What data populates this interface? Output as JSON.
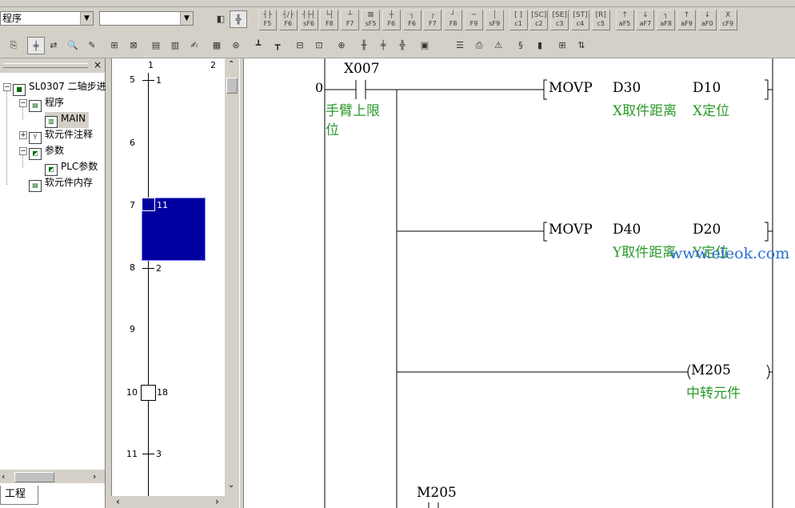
{
  "toolbar": {
    "program_combo": "程序",
    "second_combo": "",
    "fkeys": [
      {
        "glyph": "┤├",
        "label": "F5"
      },
      {
        "glyph": "┤/├",
        "label": "F6"
      },
      {
        "glyph": "┤├┤",
        "label": "sF6"
      },
      {
        "glyph": "└┤",
        "label": "F8"
      },
      {
        "glyph": "┴",
        "label": "F7"
      },
      {
        "glyph": "⊠",
        "label": "sF5"
      },
      {
        "glyph": "┼",
        "label": "F6"
      },
      {
        "glyph": "┐",
        "label": "F6"
      },
      {
        "glyph": "┌",
        "label": "F7"
      },
      {
        "glyph": "┘",
        "label": "F8"
      },
      {
        "glyph": "─",
        "label": "F9"
      },
      {
        "glyph": "│",
        "label": "sF9"
      },
      {
        "glyph": "[ ]",
        "label": "c1"
      },
      {
        "glyph": "[SC]",
        "label": "c2"
      },
      {
        "glyph": "[SE]",
        "label": "c3"
      },
      {
        "glyph": "[ST]",
        "label": "c4"
      },
      {
        "glyph": "[R]",
        "label": "c5"
      },
      {
        "glyph": "↑",
        "label": "aF5"
      },
      {
        "glyph": "↓",
        "label": "aF7"
      },
      {
        "glyph": "┐",
        "label": "aF8"
      },
      {
        "glyph": "↑",
        "label": "aF9"
      },
      {
        "glyph": "↓",
        "label": "aF0"
      },
      {
        "glyph": "X",
        "label": "cF9"
      }
    ]
  },
  "tree": {
    "items": [
      {
        "label": "SL0307 二轴步进",
        "icon": "project-icon"
      },
      {
        "label": "程序",
        "icon": "program-icon"
      },
      {
        "label": "MAIN",
        "icon": "main-program-icon"
      },
      {
        "label": "软元件注释",
        "icon": "comment-icon"
      },
      {
        "label": "参数",
        "icon": "parameter-icon"
      },
      {
        "label": "PLC参数",
        "icon": "plc-parameter-icon"
      },
      {
        "label": "软元件内存",
        "icon": "memory-icon"
      }
    ],
    "tab": "工程"
  },
  "sfc": {
    "col_headers": [
      "1",
      "2"
    ],
    "rows": [
      {
        "row": "5",
        "label": "1"
      },
      {
        "row": "6",
        "label": ""
      },
      {
        "row": "7",
        "label": "11"
      },
      {
        "row": "8",
        "label": "2"
      },
      {
        "row": "9",
        "label": ""
      },
      {
        "row": "10",
        "label": "18"
      },
      {
        "row": "11",
        "label": "3"
      }
    ]
  },
  "ladder": {
    "step": "0",
    "contact1": "X007",
    "contact1_comment": [
      "手臂上限",
      "位"
    ],
    "rung1": {
      "instr": "MOVP",
      "op1": "D30",
      "op2": "D10",
      "c1": "X取件距离",
      "c2": "X定位"
    },
    "rung2": {
      "instr": "MOVP",
      "op1": "D40",
      "op2": "D20",
      "c1": "Y取件距离",
      "c2": "Y定位"
    },
    "coil": {
      "name": "M205",
      "comment": "中转元件"
    },
    "contact2": "M205",
    "watermark": "www.eleok.com"
  },
  "colors": {
    "selected_step": "#0000a0",
    "comment": "#2a9a2a",
    "watermark": "#2a6fd6"
  }
}
